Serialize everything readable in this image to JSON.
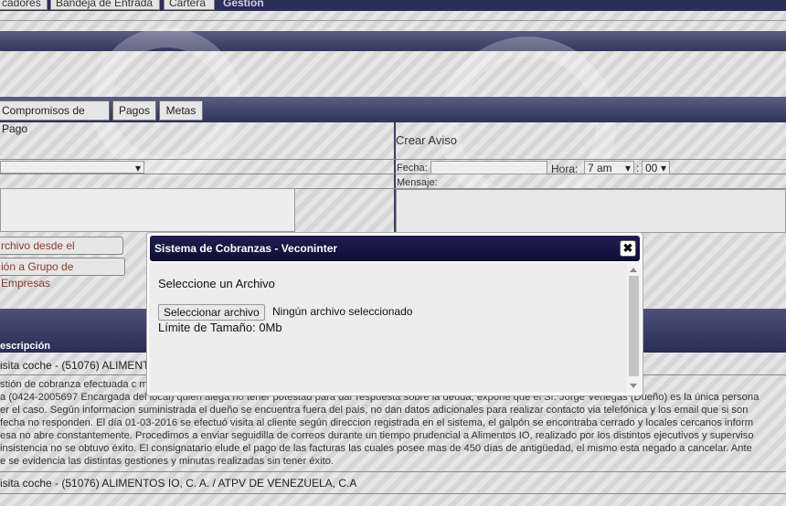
{
  "top_tabs": [
    "cadores",
    "Bandeja de Entrada",
    "Cartera",
    "Gestión"
  ],
  "sub_tabs": [
    "Compromisos de Pago",
    "Pagos",
    "Metas"
  ],
  "crear_aviso": {
    "title": "Crear Aviso",
    "fecha_label": "Fecha:",
    "hora_label": "Hora:",
    "hora_value": "7 am",
    "minuto_value": "00",
    "mensaje_label": "Mensaje:"
  },
  "left_buttons": [
    "rchivo desde el Equipo...",
    "ión a Grupo de Empresas"
  ],
  "table": {
    "column_header": "escripción",
    "rows": [
      "isita coche - (51076) ALIMENTO",
      "isita coche - (51076) ALIMENTOS IO, C. A. / ATPV DE VENEZUELA, C.A"
    ],
    "description_lines": [
      "stión de cobranza efectuada c                                                                                                                                              mente se ha conversado con la",
      "a (0424-2005697 Encargada del local) quien alega no tener potestad para dar respuesta sobre la deuda, expone que el Sr. Jorge Venegas (Dueño) es la única persona",
      "er el caso. Según informacion suministrada el dueño se encuentra fuera del país, no dan datos adicionales para realizar contacto via telefónica y los email que si son",
      "fecha no responden. El día 01-03-2016 se efectuó visita al cliente según direccion registrada en el sistema, el galpón se encontraba cerrado y locales cercanos inform",
      "esa no abre constantemente. Procedimos a enviar seguidilla de correos durante un tiempo prudencial a Alimentos IO, realizado por los distintos ejecutivos y superviso",
      " insistencia no se obtuvo éxito. El consignatario elude el pago de las facturas las cuales posee mas de 450 días de antigüedad, el mismo esta negado a cancelar. Ante",
      "e se evidencia las distintas gestiones y minutas realizadas sin tener éxito."
    ]
  },
  "modal": {
    "title": "Sistema de Cobranzas - Veconinter",
    "close_glyph": "✖",
    "heading": "Seleccione un Archivo",
    "file_button": "Seleccionar archivo",
    "file_status": "Ningún archivo seleccionado",
    "size_limit": "Límite de Tamaño: 0Mb"
  }
}
